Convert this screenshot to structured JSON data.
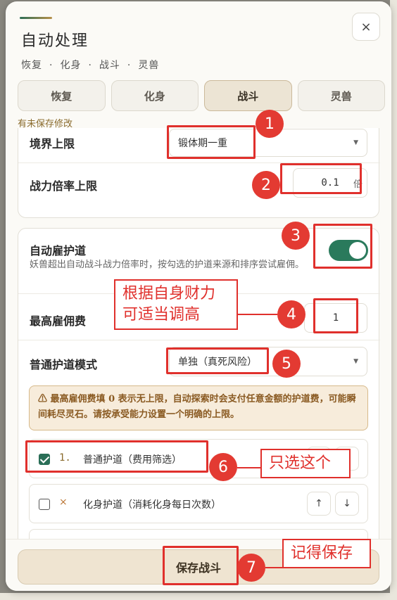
{
  "dialog": {
    "title": "自动处理",
    "breadcrumb": [
      "恢复",
      "化身",
      "战斗",
      "灵兽"
    ],
    "close_icon": "×",
    "tabs": [
      {
        "label": "恢复",
        "active": false
      },
      {
        "label": "化身",
        "active": false
      },
      {
        "label": "战斗",
        "active": true
      },
      {
        "label": "灵兽",
        "active": false
      }
    ],
    "unsaved_notice": "有未保存修改"
  },
  "battle": {
    "realm_limit": {
      "label": "境界上限",
      "value": "锻体期一重"
    },
    "power_ratio_limit": {
      "label": "战力倍率上限",
      "value": "0.1",
      "unit": "倍"
    }
  },
  "escort": {
    "title": "自动雇护道",
    "enabled": true,
    "description": "妖兽超出自动战斗战力倍率时，按勾选的护道来源和排序尝试雇佣。",
    "max_fee": {
      "label": "最高雇佣费",
      "value": "1"
    },
    "mode": {
      "label": "普通护道模式",
      "value": "单独（真死风险）"
    },
    "warning_icon": "⚠",
    "warning": "最高雇佣费填 0 表示无上限，自动探索时会支付任意金额的护道费，可能瞬间耗尽灵石。请按承受能力设置一个明确的上限。",
    "options": [
      {
        "checked": true,
        "index": "1.",
        "label": "普通护道（费用筛选）"
      },
      {
        "checked": false,
        "index": "×",
        "label": "化身护道（消耗化身每日次数）"
      }
    ],
    "up_icon": "↑",
    "down_icon": "↓"
  },
  "footer": {
    "save_label": "保存战斗"
  },
  "annotations": {
    "markers": [
      "1",
      "2",
      "3",
      "4",
      "5",
      "6",
      "7"
    ],
    "note_4": "根据自身财力可适当调高",
    "note_6": "只选这个",
    "note_7": "记得保存"
  },
  "colors": {
    "accent_green": "#2a7a5c",
    "annotation_red": "#e0302c",
    "warning_bg": "#f7ecdb"
  }
}
